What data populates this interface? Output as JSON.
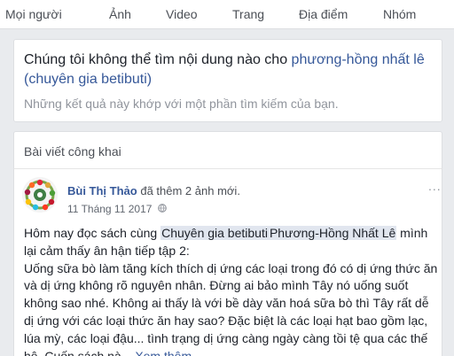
{
  "tabs": [
    "Mọi người",
    "Ảnh",
    "Video",
    "Trang",
    "Địa điểm",
    "Nhóm"
  ],
  "no_results": {
    "title_prefix": "Chúng tôi không thể tìm nội dung nào cho ",
    "query": "phương-hồng nhất lê (chuyên gia betibuti)",
    "subtitle": "Những kết quả này khớp với một phần tìm kiếm của bạn."
  },
  "section": {
    "title": "Bài viết công khai"
  },
  "post": {
    "author": "Bùi Thị Thảo",
    "action": "đã thêm 2 ảnh mới.",
    "date": "11 Tháng 11 2017",
    "more_label": "...",
    "line1_before": "Hôm nay đọc sách cùng ",
    "mention1": "Chuyên gia betibuti",
    "mention2": "Phương-Hồng Nhất Lê",
    "line1_after": " mình lại cảm thấy ân hận tiếp tập 2:",
    "body": "Uống sữa bò làm tăng kích thích dị ứng các loại trong đó có dị ứng thức ăn và dị ứng không rõ nguyên nhân. Đừng ai bảo mình Tây nó uống suốt không sao nhé. Không ai thấy là với bề dày văn hoá sữa bò thì Tây rất dễ dị ứng với các loại thức ăn hay sao? Đặc biệt là các loại hạt bao gồm lạc, lúa mỳ, các loại đậu... tình trạng dị ứng càng ngày càng tồi tệ qua các thế hệ. Cuốn sách nà...",
    "see_more": "Xem thêm"
  },
  "colors": {
    "link": "#365899",
    "muted": "#90949c",
    "background": "#e9ebee",
    "mention_bg": "#e1e6ef"
  }
}
